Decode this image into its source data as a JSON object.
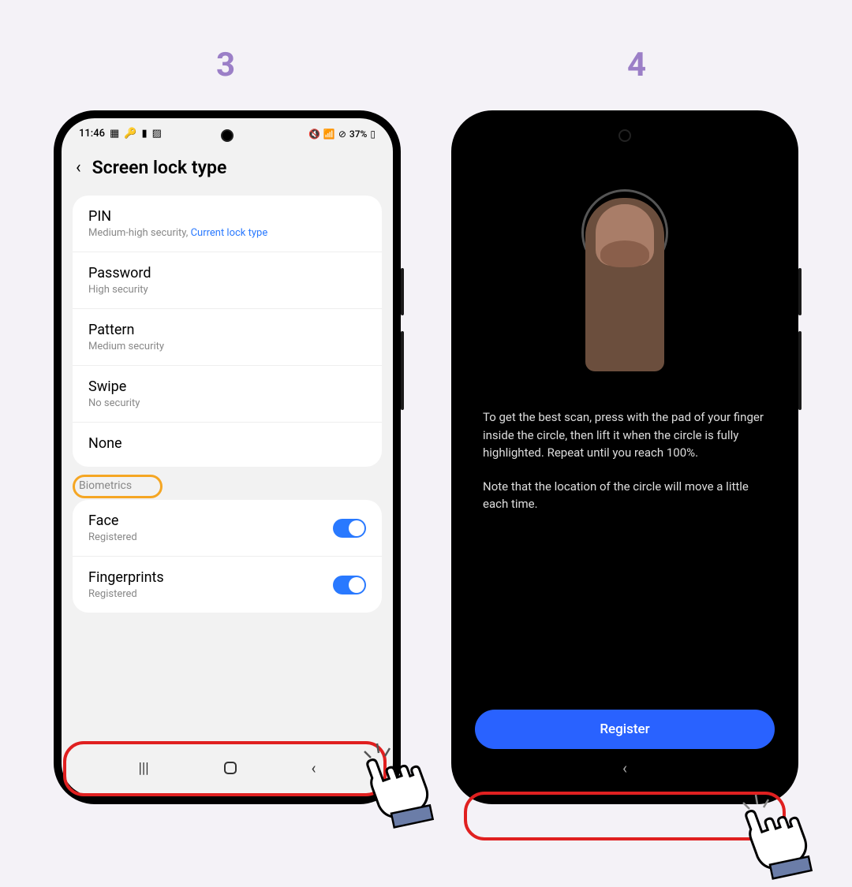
{
  "steps": {
    "s3": "3",
    "s4": "4"
  },
  "statusBar": {
    "time": "11:46",
    "battery": "37%"
  },
  "header": {
    "title": "Screen lock type"
  },
  "lockTypes": [
    {
      "title": "PIN",
      "sub": "Medium-high security, ",
      "current": "Current lock type"
    },
    {
      "title": "Password",
      "sub": "High security",
      "current": ""
    },
    {
      "title": "Pattern",
      "sub": "Medium security",
      "current": ""
    },
    {
      "title": "Swipe",
      "sub": "No security",
      "current": ""
    },
    {
      "title": "None",
      "sub": "",
      "current": ""
    }
  ],
  "biometricsLabel": "Biometrics",
  "biometrics": [
    {
      "title": "Face",
      "sub": "Registered"
    },
    {
      "title": "Fingerprints",
      "sub": "Registered"
    }
  ],
  "instructions": {
    "p1": "To get the best scan, press with the pad of your finger inside the circle, then lift it when the circle is fully highlighted. Repeat until you reach 100%.",
    "p2": "Note that the location of the circle will move a little each time."
  },
  "registerBtn": "Register"
}
